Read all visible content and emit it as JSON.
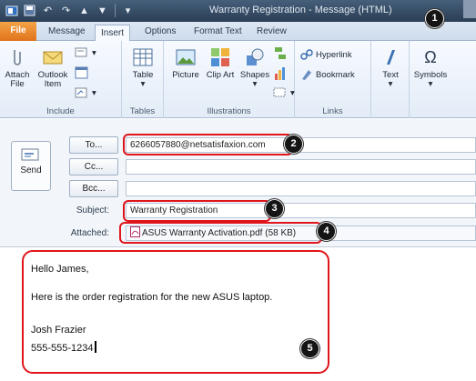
{
  "window": {
    "title": "Warranty Registration - Message (HTML)"
  },
  "tabs": [
    {
      "label": "File"
    },
    {
      "label": "Message"
    },
    {
      "label": "Insert"
    },
    {
      "label": "Options"
    },
    {
      "label": "Format Text"
    },
    {
      "label": "Review"
    }
  ],
  "ribbon": {
    "include": {
      "label": "Include",
      "attach_file": "Attach File",
      "outlook_item": "Outlook Item"
    },
    "tables": {
      "label": "Tables",
      "table": "Table"
    },
    "illustrations": {
      "label": "Illustrations",
      "picture": "Picture",
      "clip_art": "Clip Art",
      "shapes": "Shapes"
    },
    "links": {
      "label": "Links",
      "hyperlink": "Hyperlink",
      "bookmark": "Bookmark"
    },
    "text": "Text",
    "symbols": "Symbols"
  },
  "compose": {
    "send_label": "Send",
    "to_label": "To...",
    "cc_label": "Cc...",
    "bcc_label": "Bcc...",
    "to_value": "6266057880@netsatisfaxion.com",
    "cc_value": "",
    "bcc_value": "",
    "subject_label": "Subject:",
    "subject_value": "Warranty Registration",
    "attached_label": "Attached:",
    "attachment_name": "ASUS Warranty Activation.pdf (58 KB)"
  },
  "body": {
    "greeting": "Hello James,",
    "line1": "Here is the order registration for the new ASUS laptop.",
    "signature_name": "Josh Frazier",
    "signature_phone": "555-555-1234"
  },
  "annotations": [
    "1",
    "2",
    "3",
    "4",
    "5"
  ],
  "colors": {
    "highlight": "#e0151b",
    "file_tab": "#e8862a",
    "badge": "#151515"
  }
}
